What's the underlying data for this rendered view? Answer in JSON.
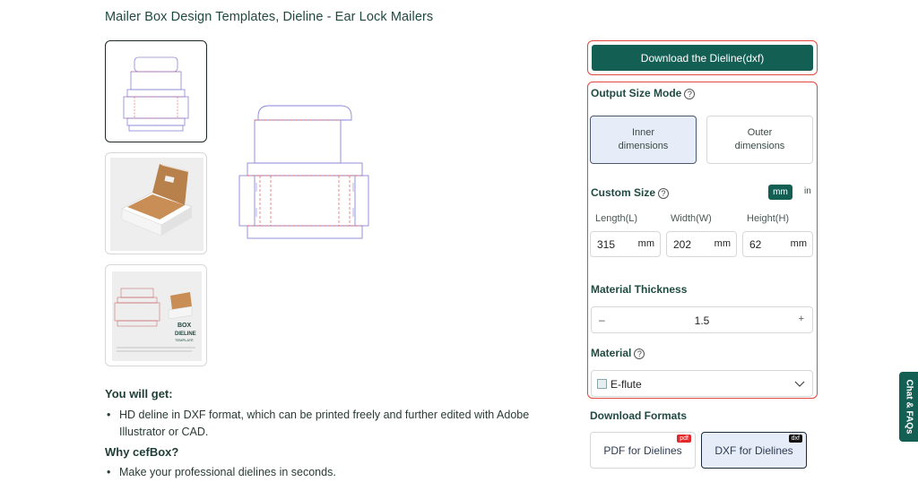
{
  "page": {
    "title": "Mailer Box Design Templates, Dieline - Ear Lock Mailers"
  },
  "thumbnails": [
    {
      "name": "dieline",
      "active": true
    },
    {
      "name": "box-photo",
      "active": false
    },
    {
      "name": "dieline-template-poster",
      "active": false,
      "poster_title_1": "BOX",
      "poster_title_2": "DIELINE",
      "poster_title_3": "TEMPLATE"
    }
  ],
  "description": {
    "you_will_get_title": "You will get:",
    "you_will_get_items": [
      "HD deline in DXF format, which can be printed freely and further edited with Adobe Illustrator or CAD."
    ],
    "why_title": "Why cefBox?",
    "why_items": [
      "Make your professional dielines in seconds."
    ]
  },
  "download": {
    "button_label": "Download the Dieline(dxf)"
  },
  "output_size": {
    "label": "Output Size Mode",
    "help_icon": "?",
    "options": [
      {
        "line1": "Inner",
        "line2": "dimensions",
        "selected": true
      },
      {
        "line1": "Outer",
        "line2": "dimensions",
        "selected": false
      }
    ]
  },
  "custom_size": {
    "label": "Custom Size",
    "help_icon": "?",
    "units": [
      "mm",
      "in"
    ],
    "selected_unit": "mm",
    "fields": [
      {
        "label": "Length(L)",
        "value": "315",
        "unit": "mm"
      },
      {
        "label": "Width(W)",
        "value": "202",
        "unit": "mm"
      },
      {
        "label": "Height(H)",
        "value": "62",
        "unit": "mm"
      }
    ]
  },
  "material_thickness": {
    "label": "Material Thickness",
    "value": "1.5",
    "minus": "–",
    "plus": "+"
  },
  "material": {
    "label": "Material",
    "help_icon": "?",
    "value": "E-flute"
  },
  "download_formats": {
    "label": "Download Formats",
    "options": [
      {
        "label": "PDF for Dielines",
        "badge": "pdf",
        "badge_color": "#e0292b",
        "selected": false
      },
      {
        "label": "DXF for Dielines",
        "badge": "dxf",
        "badge_color": "#111111",
        "selected": true
      }
    ]
  },
  "chat": {
    "label": "Chat & FAQs"
  },
  "colors": {
    "accent": "#145f54",
    "highlight_border": "#e0493d",
    "selected_bg": "#e6edf9"
  }
}
